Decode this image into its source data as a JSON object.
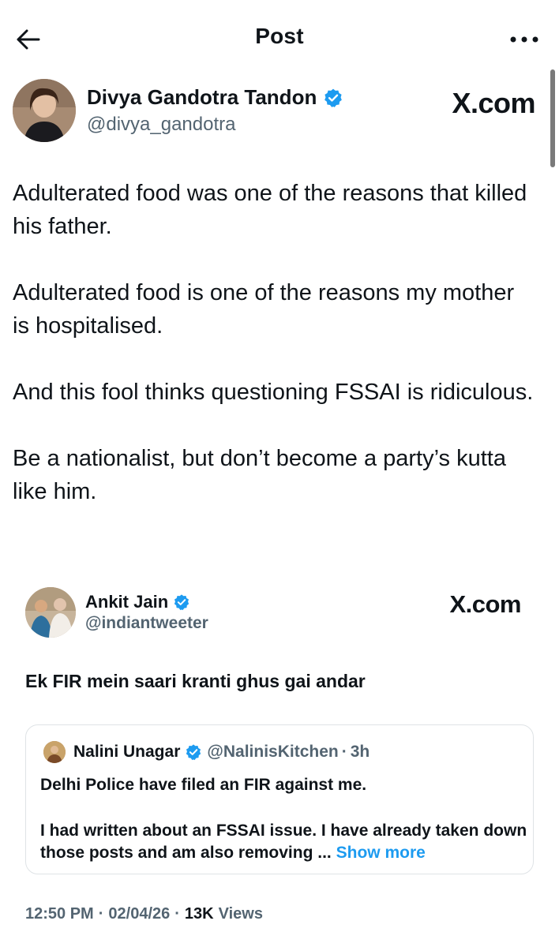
{
  "header": {
    "title": "Post",
    "back_icon": "arrow-left-icon",
    "more_icon": "more-horizontal-icon"
  },
  "author": {
    "name": "Divya Gandotra Tandon",
    "handle": "@divya_gandotra",
    "verified": true,
    "watermark": "X.com"
  },
  "post": {
    "paragraphs": [
      "Adulterated food was one of the reasons that killed his father.",
      "Adulterated food is one of the reasons my mother is hospitalised.",
      "And this fool thinks questioning FSSAI is ridiculous.",
      "Be a nationalist, but don’t become a party’s kutta like him."
    ]
  },
  "quoted": {
    "name": "Ankit Jain",
    "handle": "@indiantweeter",
    "verified": true,
    "watermark": "X.com",
    "text": "Ek FIR mein saari kranti ghus gai andar",
    "nested": {
      "name": "Nalini Unagar",
      "handle": "@NalinisKitchen",
      "separator": "·",
      "time": "3h",
      "line1": "Delhi Police have filed an FIR against me.",
      "line2": "I had written about an FSSAI issue. I have already taken down those posts and am also removing ...",
      "show_more": "Show more"
    },
    "meta": {
      "time": "12:50 PM",
      "date": "02/04/26",
      "views_count": "13K",
      "views_label": "Views",
      "separator": "·"
    }
  },
  "colors": {
    "text": "#0f1419",
    "secondary": "#536471",
    "accent": "#1d9bf0",
    "verified": "#1d9bf0",
    "border": "#dfe3e6"
  }
}
